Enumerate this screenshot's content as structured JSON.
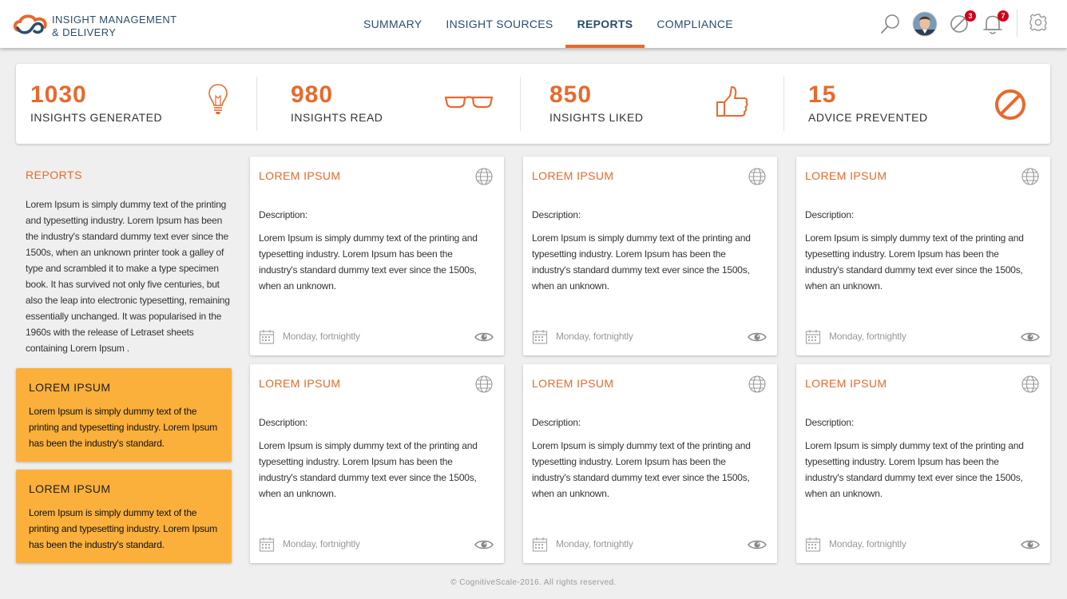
{
  "header": {
    "brand_line1": "INSIGHT MANAGEMENT",
    "brand_line2": "& DELIVERY",
    "nav": [
      {
        "label": "SUMMARY",
        "active": false
      },
      {
        "label": "INSIGHT SOURCES",
        "active": false
      },
      {
        "label": "REPORTS",
        "active": true
      },
      {
        "label": "COMPLIANCE",
        "active": false
      }
    ],
    "icons": {
      "search": "search-icon",
      "avatar": "avatar",
      "prevented": "prohibited-icon",
      "notifications": "bell-icon",
      "settings": "gear-icon"
    },
    "prevented_badge": "3",
    "notifications_badge": "7"
  },
  "stats": [
    {
      "value": "1030",
      "label": "INSIGHTS GENERATED",
      "icon": "lightbulb-icon"
    },
    {
      "value": "980",
      "label": "INSIGHTS READ",
      "icon": "glasses-icon"
    },
    {
      "value": "850",
      "label": "INSIGHTS LIKED",
      "icon": "thumbs-up-icon"
    },
    {
      "value": "15",
      "label": "ADVICE PREVENTED",
      "icon": "prohibited-icon"
    }
  ],
  "sidebar": {
    "title": "REPORTS",
    "text": "Lorem Ipsum is simply dummy text of the printing and typesetting industry. Lorem Ipsum has been the industry's standard dummy text ever since the 1500s, when an unknown printer took a galley of type and scrambled it to make a type specimen book. It has survived not only five centuries, but also the leap into electronic typesetting, remaining essentially unchanged. It was popularised in the 1960s with the release of Letraset sheets containing Lorem Ipsum .",
    "promos": [
      {
        "title": "LOREM IPSUM",
        "text": "Lorem Ipsum is simply dummy text of the printing and typesetting industry. Lorem Ipsum has been the industry's standard."
      },
      {
        "title": "LOREM IPSUM",
        "text": "Lorem Ipsum is simply dummy text of the printing and typesetting industry. Lorem Ipsum has been the industry's standard."
      }
    ]
  },
  "cards": [
    {
      "title": "LOREM IPSUM",
      "desc_label": "Description:",
      "desc": "Lorem Ipsum is simply dummy text of the printing and typesetting industry. Lorem Ipsum has been the industry's standard dummy text ever since the 1500s, when an unknown.",
      "schedule": "Monday, fortnightly"
    },
    {
      "title": "LOREM IPSUM",
      "desc_label": "Description:",
      "desc": "Lorem Ipsum is simply dummy text of the printing and typesetting industry. Lorem Ipsum has been the industry's standard dummy text ever since the 1500s, when an unknown.",
      "schedule": "Monday, fortnightly"
    },
    {
      "title": "LOREM IPSUM",
      "desc_label": "Description:",
      "desc": "Lorem Ipsum is simply dummy text of the printing and typesetting industry. Lorem Ipsum has been the industry's standard dummy text ever since the 1500s, when an unknown.",
      "schedule": "Monday, fortnightly"
    },
    {
      "title": "LOREM IPSUM",
      "desc_label": "Description:",
      "desc": "Lorem Ipsum is simply dummy text of the printing and typesetting industry. Lorem Ipsum has been the industry's standard dummy text ever since the 1500s, when an unknown.",
      "schedule": "Monday, fortnightly"
    },
    {
      "title": "LOREM IPSUM",
      "desc_label": "Description:",
      "desc": "Lorem Ipsum is simply dummy text of the printing and typesetting industry. Lorem Ipsum has been the industry's standard dummy text ever since the 1500s, when an unknown.",
      "schedule": "Monday, fortnightly"
    },
    {
      "title": "LOREM IPSUM",
      "desc_label": "Description:",
      "desc": "Lorem Ipsum is simply dummy text of the printing and typesetting industry. Lorem Ipsum has been the industry's standard dummy text ever since the 1500s, when an unknown.",
      "schedule": "Monday, fortnightly"
    }
  ],
  "footer": "© CognitiveScale-2016. All rights reserved.",
  "colors": {
    "accent": "#e8692c",
    "navy": "#2b4d6b",
    "promo": "#fbb03b",
    "badge": "#d0021b"
  }
}
